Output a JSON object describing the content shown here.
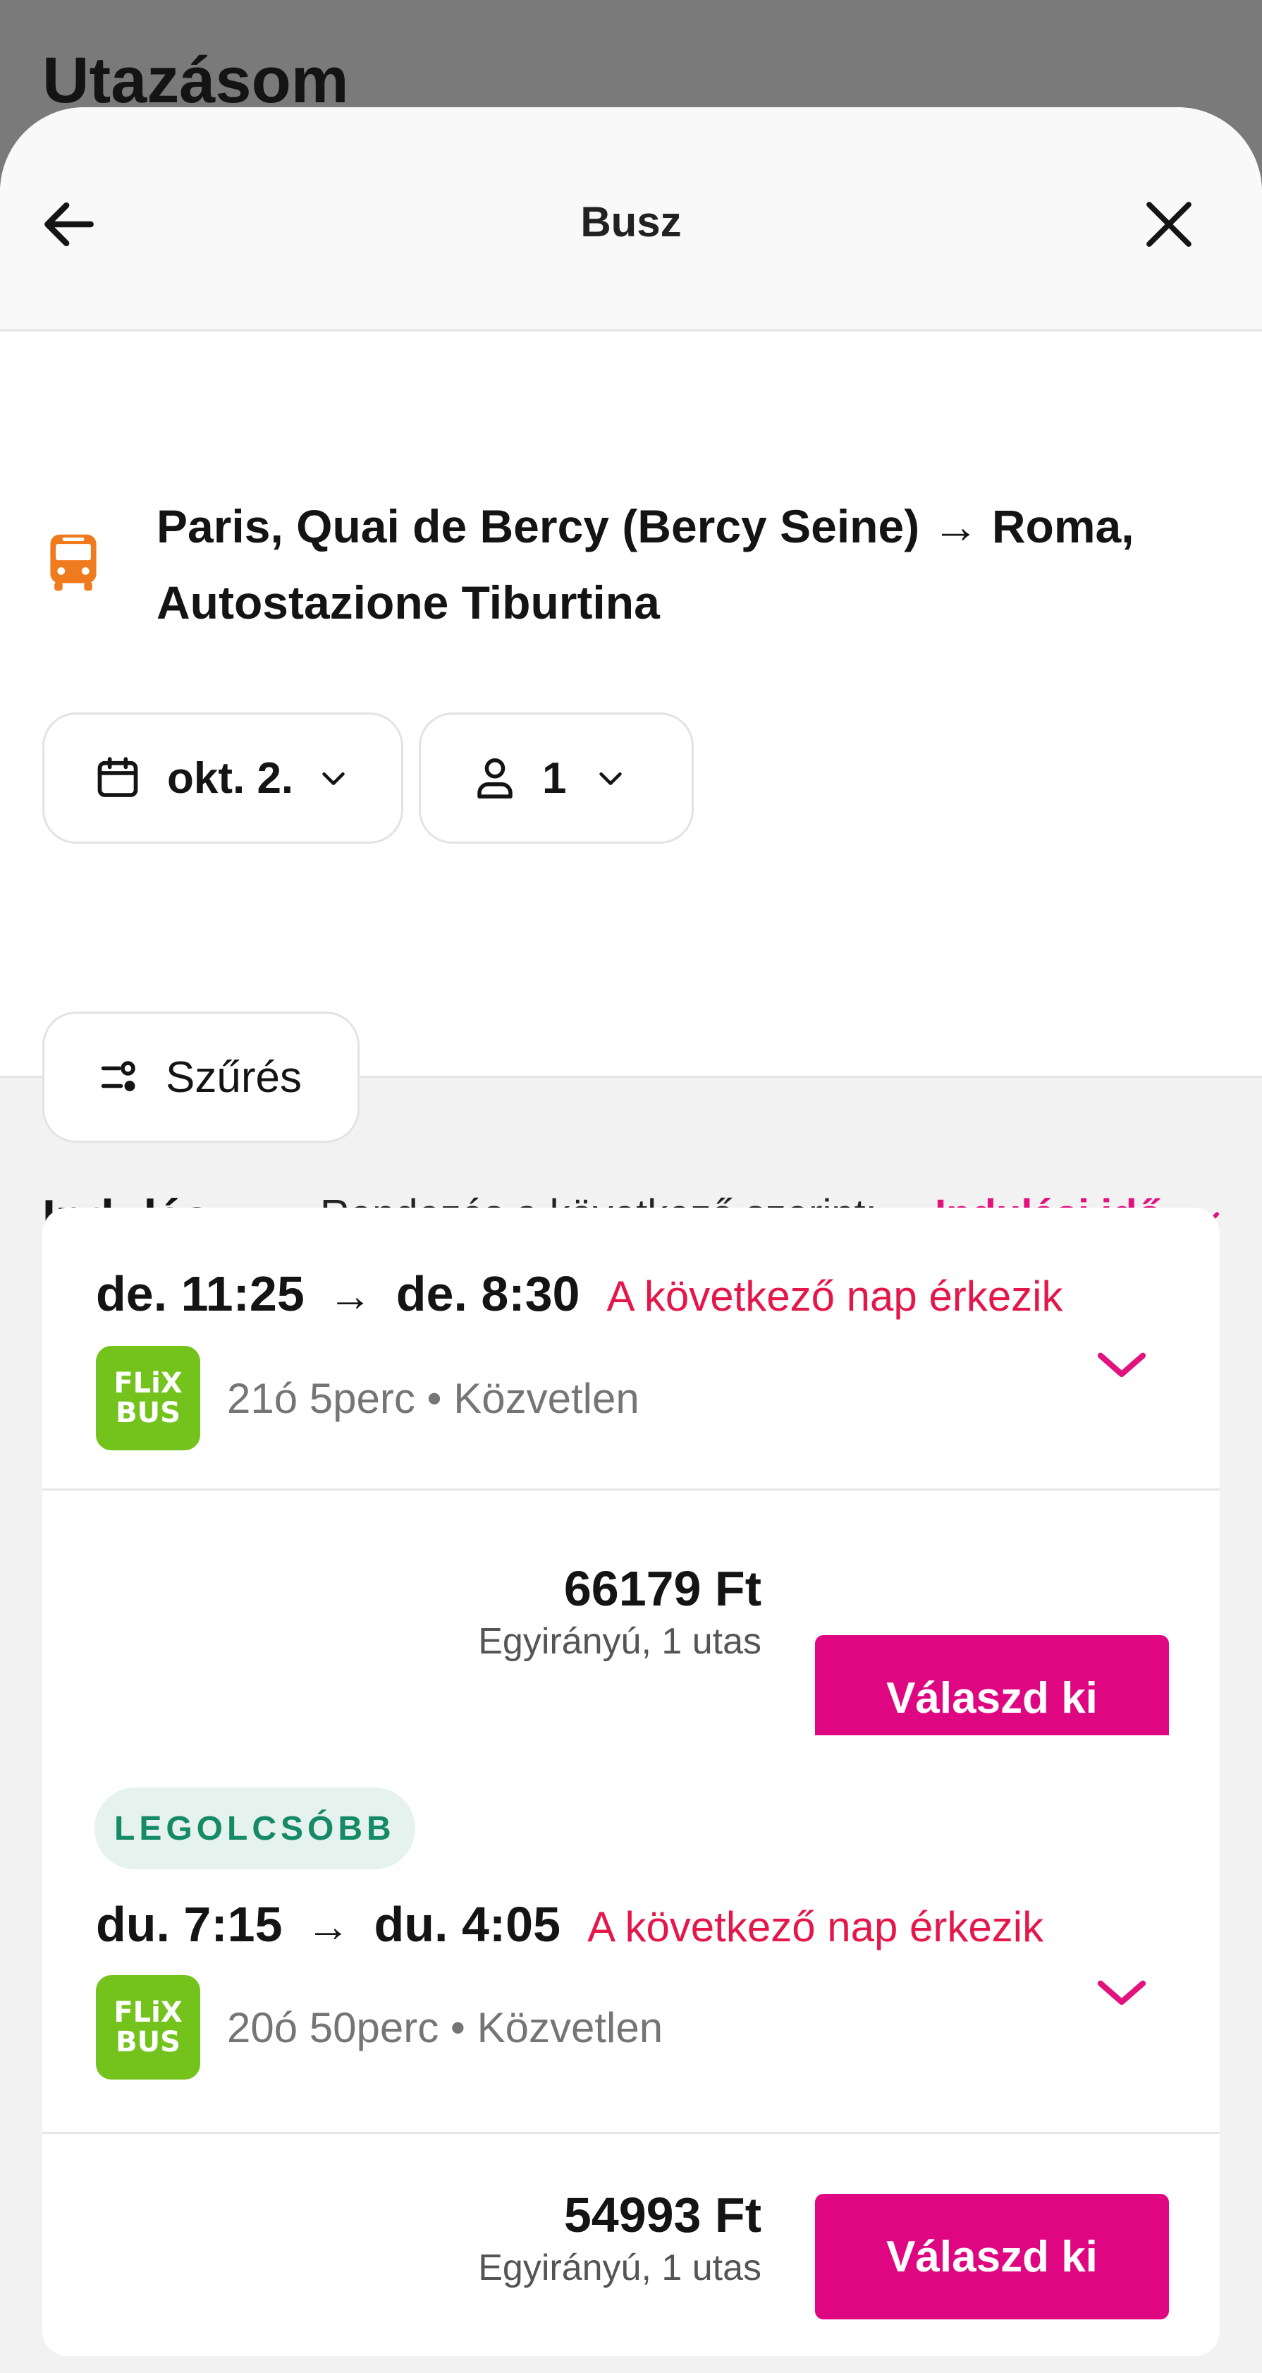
{
  "background": {
    "page_title": "Utazásom"
  },
  "sheet": {
    "title": "Busz",
    "route": "Paris, Quai de Bercy (Bercy Seine) → Roma, Autostazione Tiburtina",
    "date_chip": "okt. 2.",
    "passengers_chip": "1",
    "filter_chip": "Szűrés"
  },
  "sort": {
    "section_title": "Indulás",
    "prefix": "Rendezés a következő szerint:",
    "value": "Indulási idő"
  },
  "results": [
    {
      "departure": "de. 11:25",
      "arrow": "→",
      "arrival": "de. 8:30",
      "next_day_note": "A következő nap érkezik",
      "provider_logo_line1": "FLiX",
      "provider_logo_line2": "BUS",
      "info": "21ó 5perc • Közvetlen",
      "price": "66179 Ft",
      "price_note": "Egyirányú, 1 utas",
      "button": "Válaszd ki"
    },
    {
      "badge": "LEGOLCSÓBB",
      "departure": "du. 7:15",
      "arrow": "→",
      "arrival": "du. 4:05",
      "next_day_note": "A következő nap érkezik",
      "provider_logo_line1": "FLiX",
      "provider_logo_line2": "BUS",
      "info": "20ó 50perc • Közvetlen",
      "price": "54993 Ft",
      "price_note": "Egyirányú, 1 utas",
      "button": "Válaszd ki"
    }
  ],
  "colors": {
    "accent": "#df0781",
    "next_day": "#e3174a",
    "bus_icon": "#f07a1e",
    "flixbus_green": "#74c31d",
    "badge_text": "#148a66",
    "badge_bg": "#e5f2ee"
  },
  "icons": {
    "back": "arrow-left-icon",
    "close": "close-icon",
    "bus": "bus-icon",
    "calendar": "calendar-icon",
    "person": "person-icon",
    "filter": "filter-icon",
    "chevron": "chevron-down-icon"
  }
}
